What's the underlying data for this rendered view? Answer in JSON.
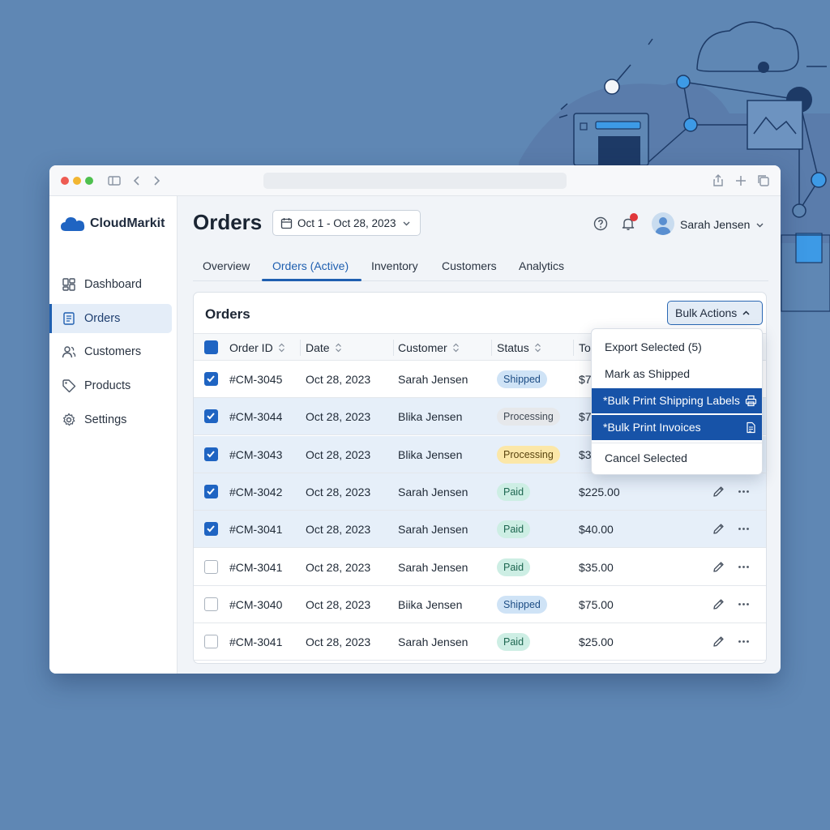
{
  "brand": {
    "name": "CloudMarkit"
  },
  "sidebar": {
    "items": [
      {
        "label": "Dashboard",
        "icon": "dashboard-icon"
      },
      {
        "label": "Orders",
        "icon": "orders-icon",
        "active": true
      },
      {
        "label": "Customers",
        "icon": "users-icon"
      },
      {
        "label": "Products",
        "icon": "tag-icon"
      },
      {
        "label": "Settings",
        "icon": "gear-icon"
      }
    ]
  },
  "header": {
    "title": "Orders",
    "date_range": "Oct 1 - Oct 28, 2023",
    "user_name": "Sarah Jensen"
  },
  "tabs": [
    {
      "label": "Overview"
    },
    {
      "label": "Orders (Active)",
      "active": true
    },
    {
      "label": "Inventory"
    },
    {
      "label": "Customers"
    },
    {
      "label": "Analytics"
    }
  ],
  "card": {
    "title": "Orders",
    "bulk_label": "Bulk Actions"
  },
  "table": {
    "columns": [
      "Order ID",
      "Date",
      "Customer",
      "Status",
      "To"
    ],
    "rows": [
      {
        "id": "#CM-3045",
        "date": "Oct 28, 2023",
        "customer": "Sarah Jensen",
        "status": "Shipped",
        "total": "$7",
        "checked": true
      },
      {
        "id": "#CM-3044",
        "date": "Oct 28, 2023",
        "customer": "Blika Jensen",
        "status": "Processing",
        "total": "$7",
        "checked": true
      },
      {
        "id": "#CM-3043",
        "date": "Oct 28, 2023",
        "customer": "Blika Jensen",
        "status": "Processing",
        "total": "$3",
        "checked": true
      },
      {
        "id": "#CM-3042",
        "date": "Oct 28, 2023",
        "customer": "Sarah Jensen",
        "status": "Paid",
        "total": "$225.00",
        "checked": true
      },
      {
        "id": "#CM-3041",
        "date": "Oct 28, 2023",
        "customer": "Sarah Jensen",
        "status": "Paid",
        "total": "$40.00",
        "checked": true
      },
      {
        "id": "#CM-3041",
        "date": "Oct 28, 2023",
        "customer": "Sarah Jensen",
        "status": "Paid",
        "total": "$35.00",
        "checked": false
      },
      {
        "id": "#CM-3040",
        "date": "Oct 28, 2023",
        "customer": "Biika Jensen",
        "status": "Shipped",
        "total": "$75.00",
        "checked": false
      },
      {
        "id": "#CM-3041",
        "date": "Oct 28, 2023",
        "customer": "Sarah Jensen",
        "status": "Paid",
        "total": "$25.00",
        "checked": false
      }
    ]
  },
  "bulk_menu": {
    "items": [
      {
        "label": "Export Selected (5)"
      },
      {
        "label": "Mark as Shipped"
      },
      {
        "label": "*Bulk Print Shipping Labels",
        "highlighted": true,
        "icon": "printer-icon"
      },
      {
        "label": "*Bulk Print Invoices",
        "highlighted": true,
        "icon": "document-icon"
      },
      {
        "label": "Cancel Selected"
      }
    ]
  },
  "colors": {
    "accent": "#1f5fb0",
    "selected_row": "#e6eff9",
    "menu_highlight": "#1753a8",
    "background": "#5f87b4"
  }
}
